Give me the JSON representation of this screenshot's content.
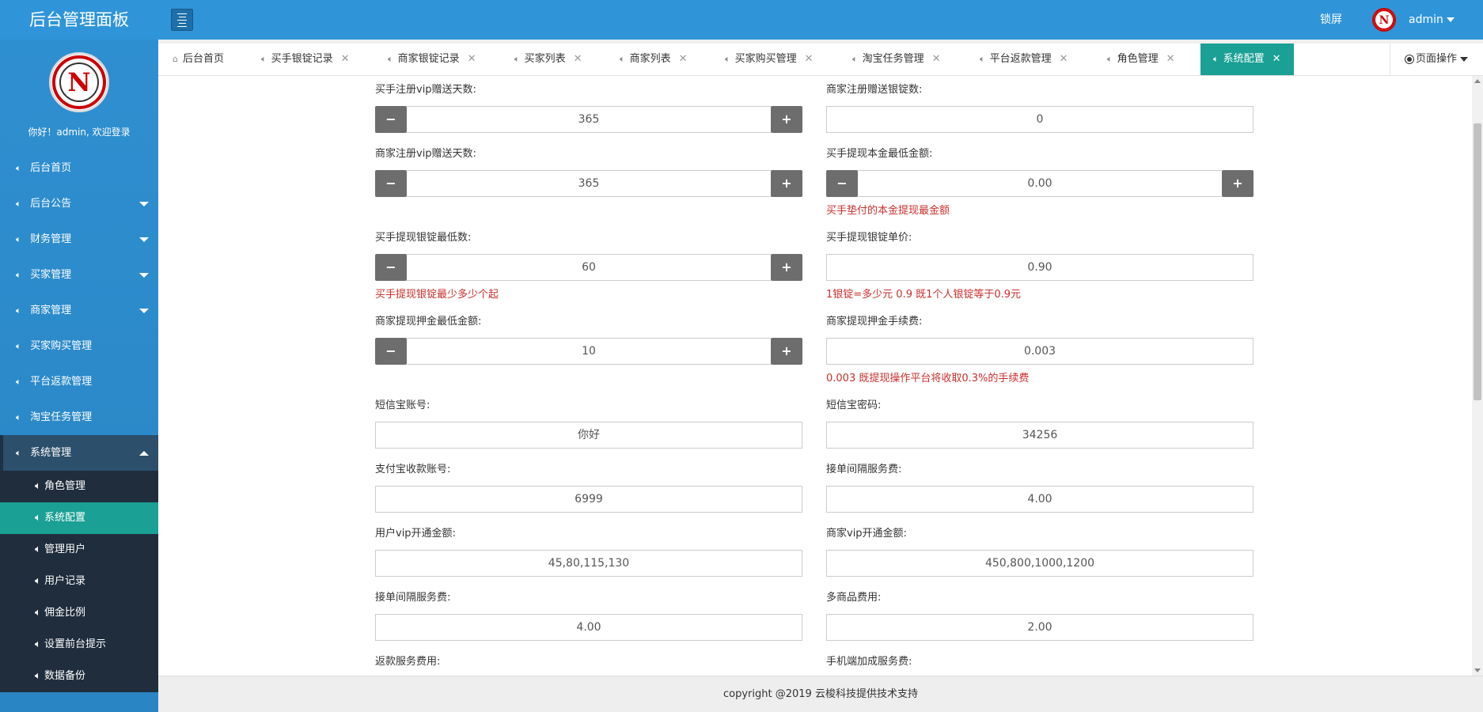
{
  "header": {
    "brand": "后台管理面板",
    "lock_label": "锁屏",
    "user_name": "admin"
  },
  "sidebar": {
    "welcome": "你好！admin, 欢迎登录",
    "items": [
      {
        "label": "后台首页",
        "has_arrow": false
      },
      {
        "label": "后台公告",
        "has_arrow": true
      },
      {
        "label": "财务管理",
        "has_arrow": true
      },
      {
        "label": "买家管理",
        "has_arrow": true
      },
      {
        "label": "商家管理",
        "has_arrow": true
      },
      {
        "label": "买家购买管理",
        "has_arrow": false
      },
      {
        "label": "平台返款管理",
        "has_arrow": false
      },
      {
        "label": "淘宝任务管理",
        "has_arrow": false
      },
      {
        "label": "系统管理",
        "has_arrow": true,
        "open": true
      }
    ],
    "sub_items": [
      "角色管理",
      "系统配置",
      "管理用户",
      "用户记录",
      "佣金比例",
      "设置前台提示",
      "数据备份"
    ],
    "active_sub": "系统配置"
  },
  "tabs": [
    {
      "label": "后台首页",
      "closable": false,
      "icon": "home-icon"
    },
    {
      "label": "买手银锭记录",
      "closable": true,
      "icon": "speaker-icon"
    },
    {
      "label": "商家银锭记录",
      "closable": true,
      "icon": "speaker-icon"
    },
    {
      "label": "买家列表",
      "closable": true,
      "icon": "speaker-icon"
    },
    {
      "label": "商家列表",
      "closable": true,
      "icon": "speaker-icon"
    },
    {
      "label": "买家购买管理",
      "closable": true,
      "icon": "speaker-icon"
    },
    {
      "label": "淘宝任务管理",
      "closable": true,
      "icon": "speaker-icon"
    },
    {
      "label": "平台返款管理",
      "closable": true,
      "icon": "speaker-icon"
    },
    {
      "label": "角色管理",
      "closable": true,
      "icon": "speaker-icon"
    },
    {
      "label": "系统配置",
      "closable": true,
      "icon": "speaker-icon",
      "active": true
    }
  ],
  "page_ops_label": "页面操作",
  "form": {
    "buyer_vip_days": {
      "label": "买手注册vip赠送天数:",
      "value": "365"
    },
    "merchant_reg_ingots": {
      "label": "商家注册赠送银锭数:",
      "value": "0"
    },
    "merchant_vip_days": {
      "label": "商家注册vip赠送天数:",
      "value": "365"
    },
    "buyer_min_principal": {
      "label": "买手提现本金最低金额:",
      "value": "0.00",
      "help": "买手垫付的本金提现最金额"
    },
    "buyer_min_ingots": {
      "label": "买手提现银锭最低数:",
      "value": "60",
      "help": "买手提现银锭最少多少个起"
    },
    "buyer_ingot_price": {
      "label": "买手提现银锭单价:",
      "value": "0.90",
      "help": "1银锭=多少元 0.9 既1个人银锭等于0.9元"
    },
    "merchant_min_deposit": {
      "label": "商家提现押金最低金额:",
      "value": "10"
    },
    "merchant_deposit_fee": {
      "label": "商家提现押金手续费:",
      "value": "0.003",
      "help": "0.003 既提现操作平台将收取0.3%的手续费"
    },
    "sms_account": {
      "label": "短信宝账号:",
      "value": "你好"
    },
    "sms_password": {
      "label": "短信宝密码:",
      "value": "34256"
    },
    "alipay_account": {
      "label": "支付宝收款账号:",
      "value": "6999"
    },
    "order_interval_fee": {
      "label": "接单间隔服务费:",
      "value": "4.00"
    },
    "user_vip_price": {
      "label": "用户vip开通金额:",
      "value": "45,80,115,130"
    },
    "merchant_vip_price": {
      "label": "商家vip开通金额:",
      "value": "450,800,1000,1200"
    },
    "order_interval_fee2": {
      "label": "接单间隔服务费:",
      "value": "4.00"
    },
    "multi_goods_fee": {
      "label": "多商品费用:",
      "value": "2.00"
    },
    "refund_fee": {
      "label": "返款服务费用:"
    },
    "mobile_fee": {
      "label": "手机端加成服务费:"
    }
  },
  "footer": "copyright @2019 云梭科技提供技术支持",
  "colors": {
    "header": "#3095d8",
    "active": "#1aa094",
    "help": "#c9302c"
  }
}
